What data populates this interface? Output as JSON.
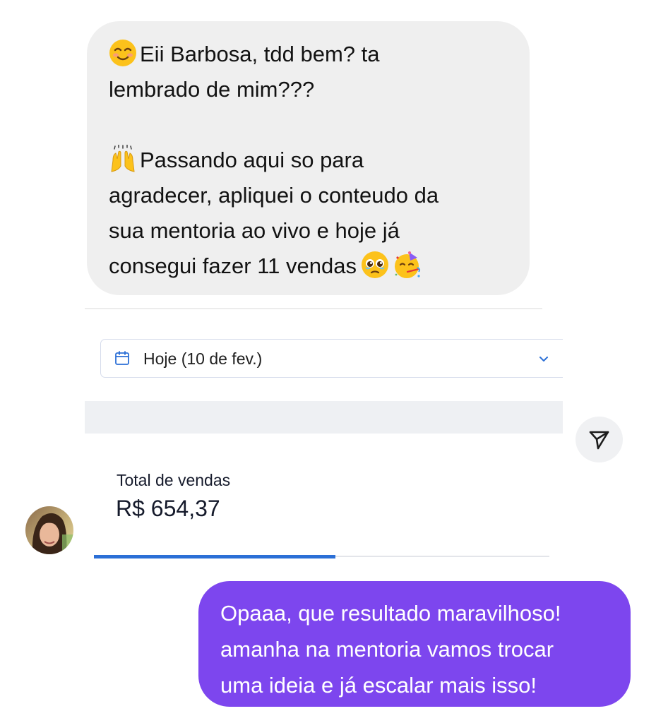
{
  "incoming_message": {
    "paragraph_1": {
      "emoji": "smiling-face-with-smiling-eyes",
      "text": "Eii Barbosa, tdd bem? ta\nlembrado de mim???"
    },
    "paragraph_2": {
      "emoji": "raising-hands",
      "text": "Passando aqui so para\nagradecer, apliquei o conteudo da\nsua mentoria ao vivo e hoje já\nconsegui fazer 11 vendas",
      "trailing_emojis": [
        "pleading-face",
        "partying-face"
      ]
    }
  },
  "sales_card": {
    "date_filter": {
      "icon": "calendar-icon",
      "label": "Hoje (10 de fev.)",
      "chevron": "chevron-down-icon"
    },
    "total_label": "Total de vendas",
    "total_value": "R$ 654,37",
    "progress_fraction": 0.53,
    "accent_color": "#2b6fd6"
  },
  "share_button": {
    "icon": "send-icon"
  },
  "sender": {
    "avatar": "profile-photo"
  },
  "outgoing_message": {
    "text": "Opaaa, que resultado maravilhoso!\namanha na mentoria vamos trocar\numa ideia e já escalar mais isso!",
    "bubble_color": "#7d46ee"
  }
}
